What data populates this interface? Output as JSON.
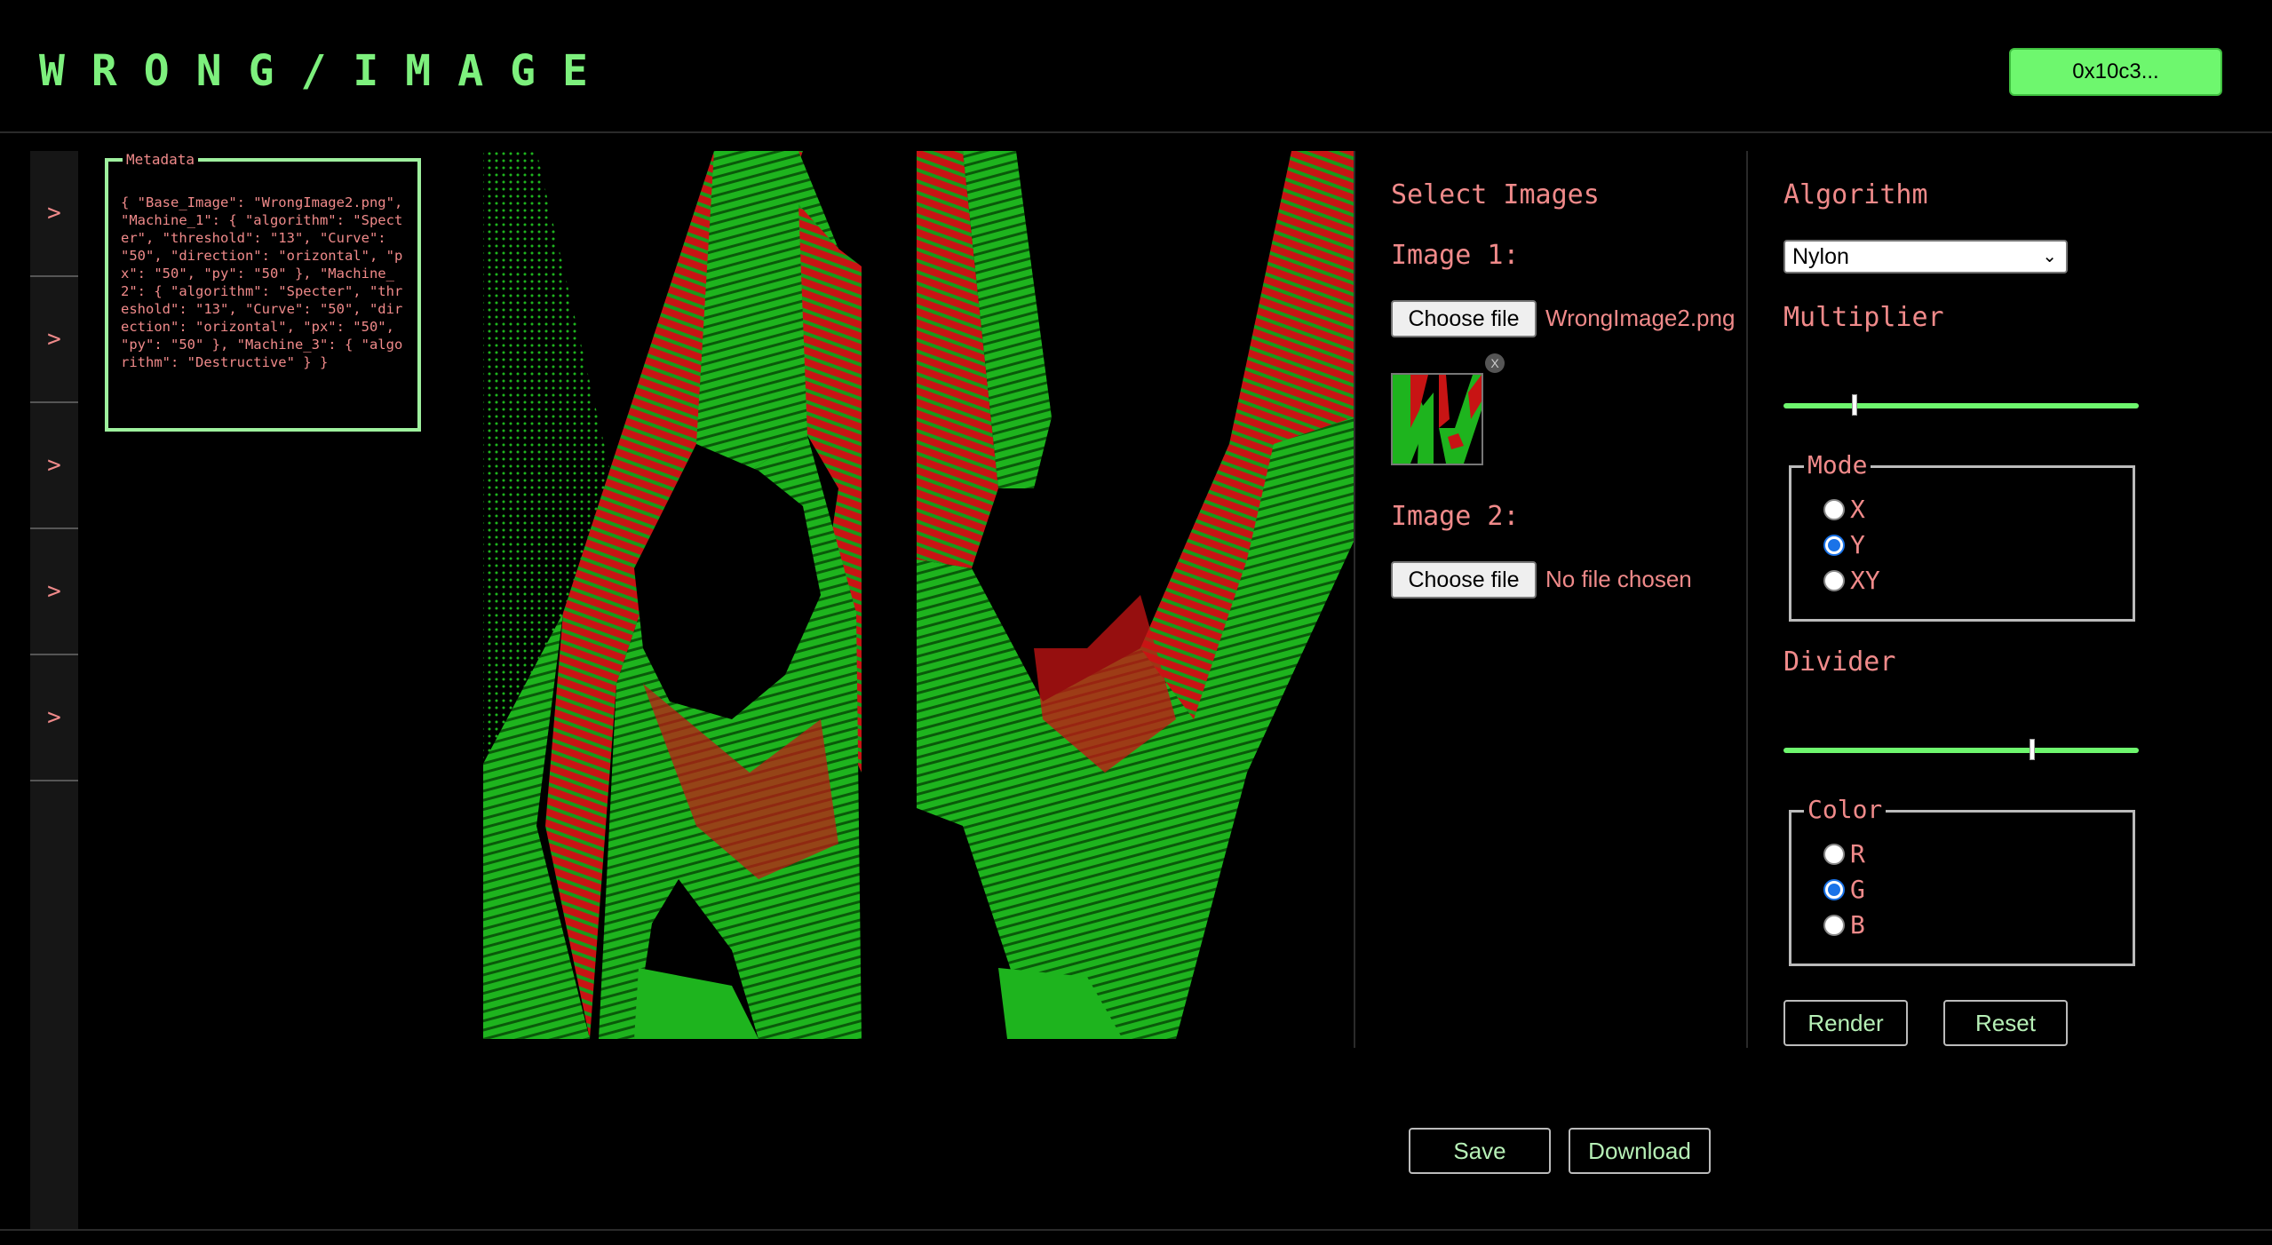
{
  "header": {
    "logo": "WRONG/IMAGE",
    "wallet_label": "0x10c3..."
  },
  "sidebar": {
    "items": [
      {
        "label": ">"
      },
      {
        "label": ">"
      },
      {
        "label": ">"
      },
      {
        "label": ">"
      },
      {
        "label": ">"
      }
    ]
  },
  "metadata": {
    "legend": "Metadata",
    "text": "{ \"Base_Image\": \"WrongImage2.png\", \"Machine_1\": { \"algorithm\": \"Specter\", \"threshold\": \"13\", \"Curve\": \"50\", \"direction\": \"orizontal\", \"px\": \"50\", \"py\": \"50\" }, \"Machine_2\": { \"algorithm\": \"Specter\", \"threshold\": \"13\", \"Curve\": \"50\", \"direction\": \"orizontal\", \"px\": \"50\", \"py\": \"50\" }, \"Machine_3\": { \"algorithm\": \"Destructive\" } }"
  },
  "images": {
    "title": "Select Images",
    "image1_label": "Image 1:",
    "image1_button": "Choose file",
    "image1_file": "WrongImage2.png",
    "thumb_remove": "X",
    "image2_label": "Image 2:",
    "image2_button": "Choose file",
    "image2_file": "No file chosen"
  },
  "controls": {
    "algorithm_label": "Algorithm",
    "algorithm_value": "Nylon",
    "multiplier_label": "Multiplier",
    "multiplier_value": 0.2,
    "mode_legend": "Mode",
    "mode_options": [
      "X",
      "Y",
      "XY"
    ],
    "mode_selected": "Y",
    "divider_label": "Divider",
    "divider_value": 0.7,
    "color_legend": "Color",
    "color_options": [
      "R",
      "G",
      "B"
    ],
    "color_selected": "G",
    "render_label": "Render",
    "reset_label": "Reset"
  },
  "actions": {
    "save_label": "Save",
    "download_label": "Download"
  },
  "colors": {
    "accent_green": "#6ef76e",
    "text_pink": "#f08a8a",
    "image_red": "#c81414",
    "image_green": "#1eb41e"
  }
}
